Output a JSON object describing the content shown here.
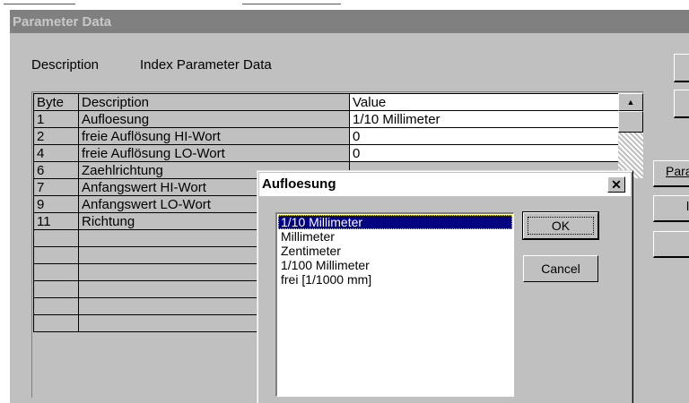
{
  "window": {
    "title": "Parameter Data"
  },
  "header": {
    "description_label": "Description",
    "description_value": "Index Parameter Data"
  },
  "table": {
    "columns": [
      "Byte",
      "Description",
      "Value"
    ],
    "rows": [
      {
        "byte": "1",
        "description": "Aufloesung",
        "value": "1/10  Millimeter"
      },
      {
        "byte": "2",
        "description": "freie Auflösung HI-Wort",
        "value": "0"
      },
      {
        "byte": "4",
        "description": "freie Auflösung LO-Wort",
        "value": "0"
      },
      {
        "byte": "6",
        "description": "Zaehlrichtung",
        "value": ""
      },
      {
        "byte": "7",
        "description": "Anfangswert HI-Wort",
        "value": ""
      },
      {
        "byte": "9",
        "description": "Anfangswert LO-Wort",
        "value": ""
      },
      {
        "byte": "11",
        "description": "Richtung",
        "value": ""
      },
      {
        "byte": "",
        "description": "",
        "value": ""
      },
      {
        "byte": "",
        "description": "",
        "value": ""
      },
      {
        "byte": "",
        "description": "",
        "value": ""
      },
      {
        "byte": "",
        "description": "",
        "value": ""
      },
      {
        "byte": "",
        "description": "",
        "value": ""
      },
      {
        "byte": "",
        "description": "",
        "value": ""
      }
    ]
  },
  "right_buttons": {
    "param_partial": "Para",
    "b2_partial": "l"
  },
  "dialog": {
    "title": "Aufloesung",
    "close_glyph": "✕",
    "options": [
      "1/10  Millimeter",
      "Millimeter",
      "Zentimeter",
      "1/100 Millimeter",
      "frei [1/1000 mm]"
    ],
    "selected_index": 0,
    "ok_label": "OK",
    "cancel_label": "Cancel"
  },
  "icons": {
    "scroll_up": "triangle-up-icon",
    "close": "close-icon"
  }
}
